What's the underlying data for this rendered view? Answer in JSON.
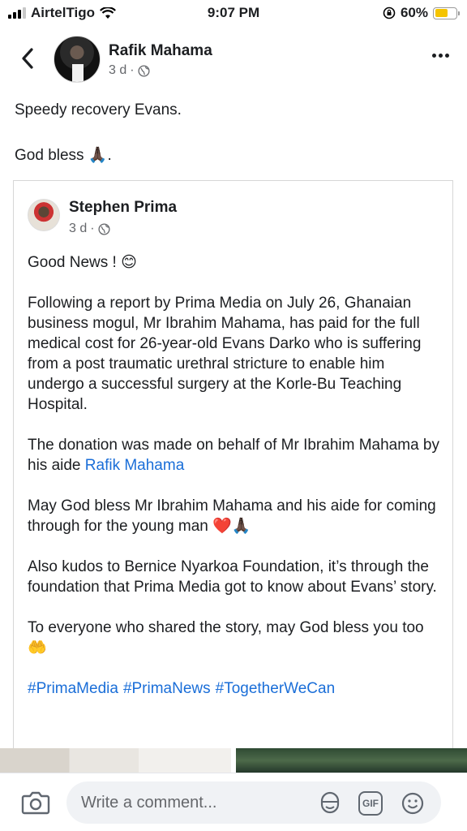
{
  "status_bar": {
    "carrier": "AirtelTigo",
    "time": "9:07 PM",
    "battery": "60%",
    "battery_level": 0.6
  },
  "header": {
    "author": "Rafik Mahama",
    "time_ago": "3 d",
    "separator": "·"
  },
  "post": {
    "line1": "Speedy recovery Evans.",
    "line2": "God bless 🙏🏿."
  },
  "shared": {
    "author": "Stephen Prima",
    "time_ago": "3 d",
    "separator": "·",
    "p1": "Good News ! 😊",
    "p2": "Following a report by Prima Media on July 26, Ghanaian business mogul, Mr Ibrahim Mahama, has paid for the full medical cost for 26-year-old Evans Darko who is suffering from a post traumatic urethral stricture to enable him undergo a successful surgery at the Korle-Bu Teaching Hospital.",
    "p3_text": "The donation was made on behalf of Mr Ibrahim Mahama by his aide ",
    "p3_link": "Rafik Mahama",
    "p4": "May God bless Mr Ibrahim Mahama and his aide for coming through for the young man ❤️🙏🏿",
    "p5": "Also kudos to Bernice Nyarkoa Foundation, it’s through the foundation that Prima Media got to know about Evans’ story.",
    "p6": "To everyone who shared the story, may God bless you too 🤲",
    "hashtags": [
      "#PrimaMedia",
      "#PrimaNews",
      "#TogetherWeCan"
    ]
  },
  "comment_bar": {
    "placeholder": "Write a comment...",
    "gif_label": "GIF"
  },
  "icons": {
    "back": "chevron-left-icon",
    "more": "more-horizontal-icon",
    "globe": "globe-icon",
    "camera": "camera-icon",
    "sticker": "sticker-icon",
    "gif": "gif-icon",
    "emoji": "emoji-icon"
  },
  "colors": {
    "link": "#1a6ed8",
    "battery_fill": "#f5c400",
    "secondary_text": "#65676b"
  }
}
